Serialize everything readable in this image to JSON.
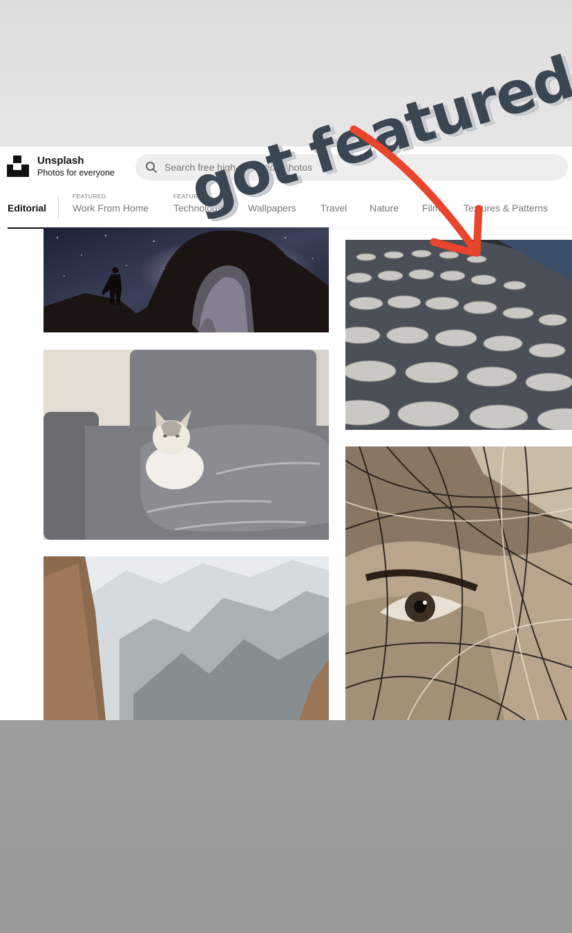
{
  "app": {
    "brand_name": "Unsplash",
    "tagline": "Photos for everyone"
  },
  "search": {
    "placeholder": "Search free high-resolution photos"
  },
  "nav": {
    "items": [
      {
        "label": "Editorial",
        "featured": "",
        "active": true
      },
      {
        "label": "Work From Home",
        "featured": "FEATURED",
        "active": false
      },
      {
        "label": "Technology",
        "featured": "FEATURED",
        "active": false
      },
      {
        "label": "Wallpapers",
        "featured": "",
        "active": false
      },
      {
        "label": "Travel",
        "featured": "",
        "active": false
      },
      {
        "label": "Nature",
        "featured": "",
        "active": false
      },
      {
        "label": "Film",
        "featured": "",
        "active": false
      },
      {
        "label": "Textures & Patterns",
        "featured": "",
        "active": false
      }
    ]
  },
  "overlay": {
    "sticker_text": "got featured",
    "arrow_color": "#e8452c"
  },
  "photos": [
    {
      "name": "night-arch-photo",
      "subject": "person silhouette under rock arch with milky way"
    },
    {
      "name": "cat-on-sofa-photo",
      "subject": "cat lying on gray sofa with blanket"
    },
    {
      "name": "misty-mountains-photo",
      "subject": "misty mountain valley"
    },
    {
      "name": "disc-facade-photo",
      "subject": "building facade covered in metal discs"
    },
    {
      "name": "street-art-face-photo",
      "subject": "graffiti portrait of a face with eye"
    }
  ],
  "colors": {
    "accent_text": "#111111",
    "muted_text": "#767676",
    "sticker": "#3a4652"
  }
}
